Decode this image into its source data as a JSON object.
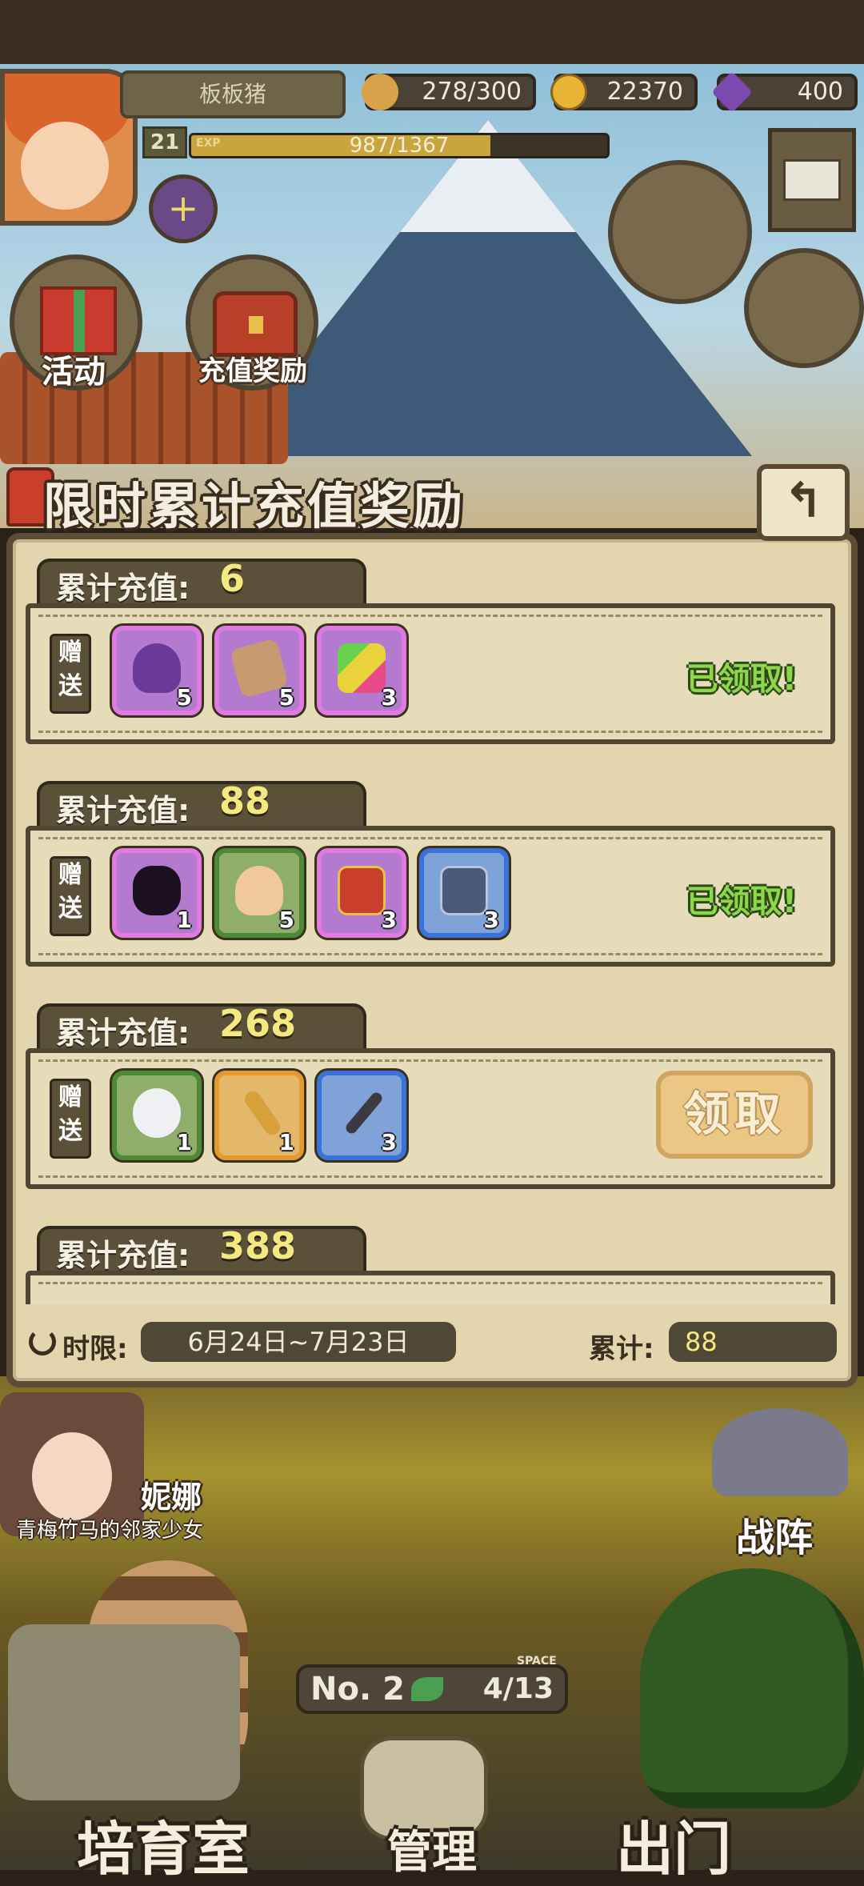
{
  "player": {
    "name": "板板猪",
    "level": "21",
    "exp_label": "EXP",
    "exp_text": "987/1367",
    "exp_progress": 0.72
  },
  "resources": {
    "stamina": "278/300",
    "gold": "22370",
    "gems": "400"
  },
  "menu": {
    "activity_label": "活动",
    "recharge_reward_label": "充值奖励"
  },
  "panel": {
    "title": "限时累计充值奖励",
    "back_symbol": "↰",
    "tier_label": "累计充值:",
    "gift_tag": "赠送",
    "tiers": [
      {
        "amount": "6",
        "items": [
          {
            "icon": "purple-potion-icon",
            "qty": "5",
            "rarity": "purple"
          },
          {
            "icon": "ticket-icon",
            "qty": "5",
            "rarity": "purple"
          },
          {
            "icon": "rainbow-book-icon",
            "qty": "3",
            "rarity": "purple"
          }
        ],
        "status": "已领取!"
      },
      {
        "amount": "88",
        "items": [
          {
            "icon": "mystery-monster-icon",
            "qty": "1",
            "rarity": "purple"
          },
          {
            "icon": "pudding-icon",
            "qty": "5",
            "rarity": "green"
          },
          {
            "icon": "red-chest-icon",
            "qty": "3",
            "rarity": "purple"
          },
          {
            "icon": "blue-chest-icon",
            "qty": "3",
            "rarity": "blue"
          }
        ],
        "status": "已领取!"
      },
      {
        "amount": "268",
        "items": [
          {
            "icon": "white-egg-icon",
            "qty": "1",
            "rarity": "green"
          },
          {
            "icon": "golden-key-icon",
            "qty": "1",
            "rarity": "orange"
          },
          {
            "icon": "pickaxe-icon",
            "qty": "3",
            "rarity": "blue"
          }
        ],
        "claim": "领取"
      },
      {
        "amount": "388",
        "items": []
      }
    ],
    "footer": {
      "time_label": "时限:",
      "time_value": "6月24日~7月23日",
      "total_label": "累计:",
      "total_value": "88"
    }
  },
  "scene": {
    "npc_name": "妮娜",
    "npc_subtitle": "青梅竹马的邻家少女",
    "battle_label": "战阵",
    "floor_label": "No. 2",
    "space_caption": "SPACE",
    "space_value": "4/13",
    "nursery_label": "培育室",
    "manage_label": "管理",
    "go_out_label": "出门"
  },
  "colors": {
    "panel_bg": "#e3d5ad",
    "panel_border": "#5c4d37",
    "claimed_green": "#8ed64a",
    "amount_yellow": "#f5e880"
  }
}
